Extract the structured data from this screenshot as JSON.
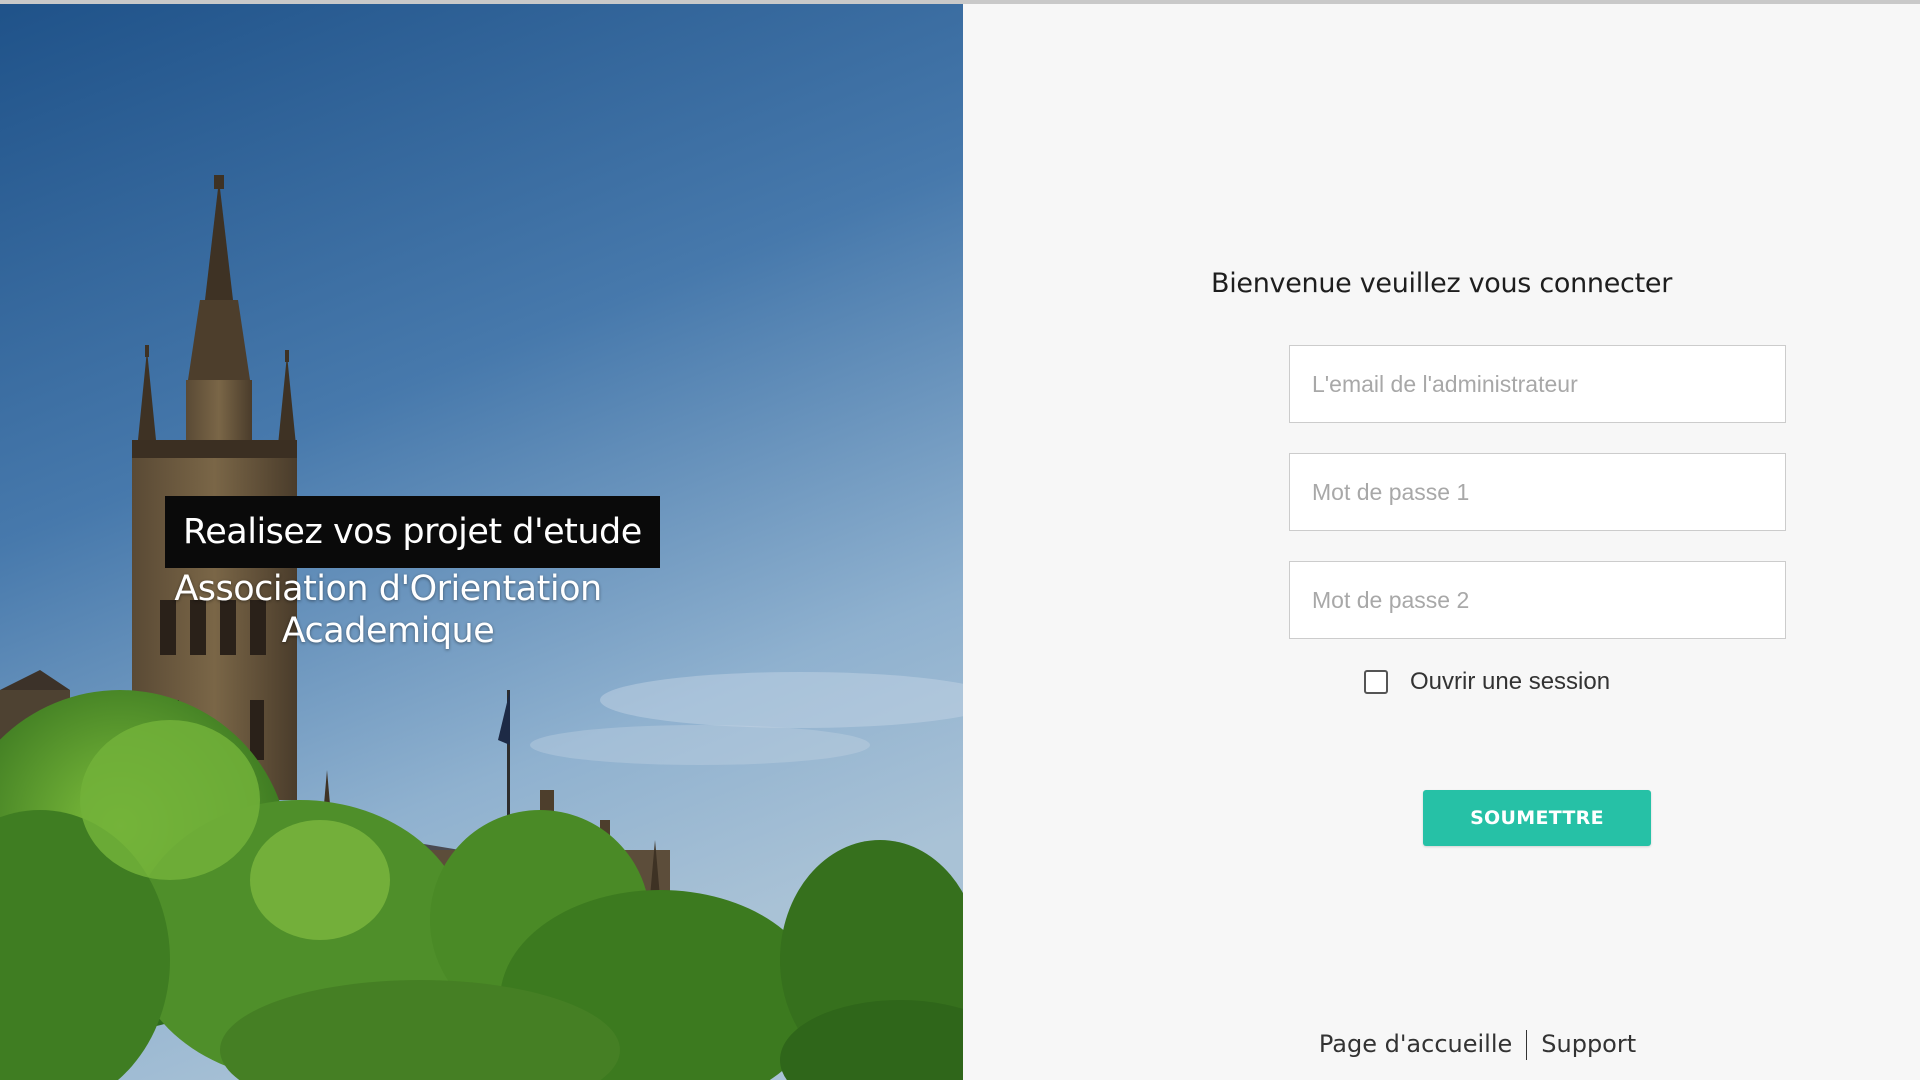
{
  "hero": {
    "image": "university-tower-photo",
    "tagline": "Realisez vos projet d'etude",
    "organization": "Association d'Orientation Academique"
  },
  "login": {
    "title": "Bienvenue veuillez vous connecter",
    "email_placeholder": "L'email de l'administrateur",
    "password1_placeholder": "Mot de passe 1",
    "password2_placeholder": "Mot de passe 2",
    "remember_label": "Ouvrir une session",
    "remember_checked": false,
    "submit_label": "SOUMETTRE"
  },
  "footer": {
    "links": [
      {
        "label": "Page d'accueille"
      },
      {
        "label": "Support"
      }
    ]
  },
  "colors": {
    "accent": "#26c1a6",
    "panel_background": "#f7f7f7",
    "tagline_background": "#0a0a0a"
  }
}
